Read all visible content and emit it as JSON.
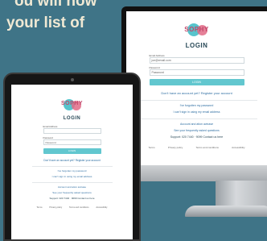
{
  "headline": {
    "line1": "ou will now",
    "line2": "your list of"
  },
  "login_page": {
    "logo_text": "SOPHY",
    "title": "LOGIN",
    "email_label": "Email Address",
    "email_value": "joe@email.com",
    "password_label": "Password",
    "password_placeholder": "Password",
    "login_button": "LOGIN",
    "no_account": "Don't have an account yet? Register your account",
    "forgot_password": "I've forgotten my password",
    "cant_sign_in": "I can't sign in using my email address",
    "account_email": "Account and ation avinase",
    "usernames": "See your frequently asked questions",
    "support": "Support: 020 7440 · 9099 Contact us here",
    "footer": [
      "Terms",
      "Privacy policy",
      "Terms and conditions",
      "Accessibility"
    ]
  }
}
